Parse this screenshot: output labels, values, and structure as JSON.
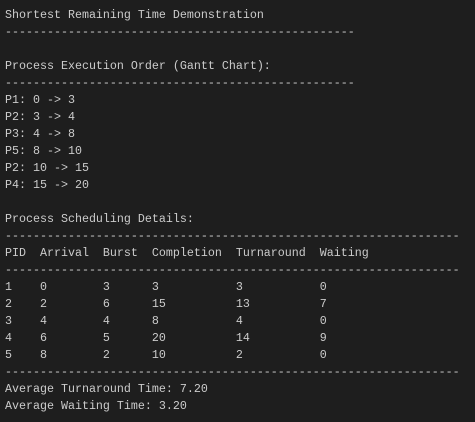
{
  "title": "Shortest Remaining Time Demonstration",
  "separator_short": "--------------------------------------------------",
  "separator_long": "-----------------------------------------------------------------",
  "gantt": {
    "heading": "Process Execution Order (Gantt Chart):",
    "entries": [
      "P1: 0 -> 3",
      "P2: 3 -> 4",
      "P3: 4 -> 8",
      "P5: 8 -> 10",
      "P2: 10 -> 15",
      "P4: 15 -> 20"
    ]
  },
  "details": {
    "heading": "Process Scheduling Details:",
    "columns": [
      "PID",
      "Arrival",
      "Burst",
      "Completion",
      "Turnaround",
      "Waiting"
    ],
    "rows": [
      [
        "1",
        "0",
        "3",
        "3",
        "3",
        "0"
      ],
      [
        "2",
        "2",
        "6",
        "15",
        "13",
        "7"
      ],
      [
        "3",
        "4",
        "4",
        "8",
        "4",
        "0"
      ],
      [
        "4",
        "6",
        "5",
        "20",
        "14",
        "9"
      ],
      [
        "5",
        "8",
        "2",
        "10",
        "2",
        "0"
      ]
    ]
  },
  "averages": {
    "turnaround": "Average Turnaround Time: 7.20",
    "waiting": "Average Waiting Time: 3.20"
  }
}
